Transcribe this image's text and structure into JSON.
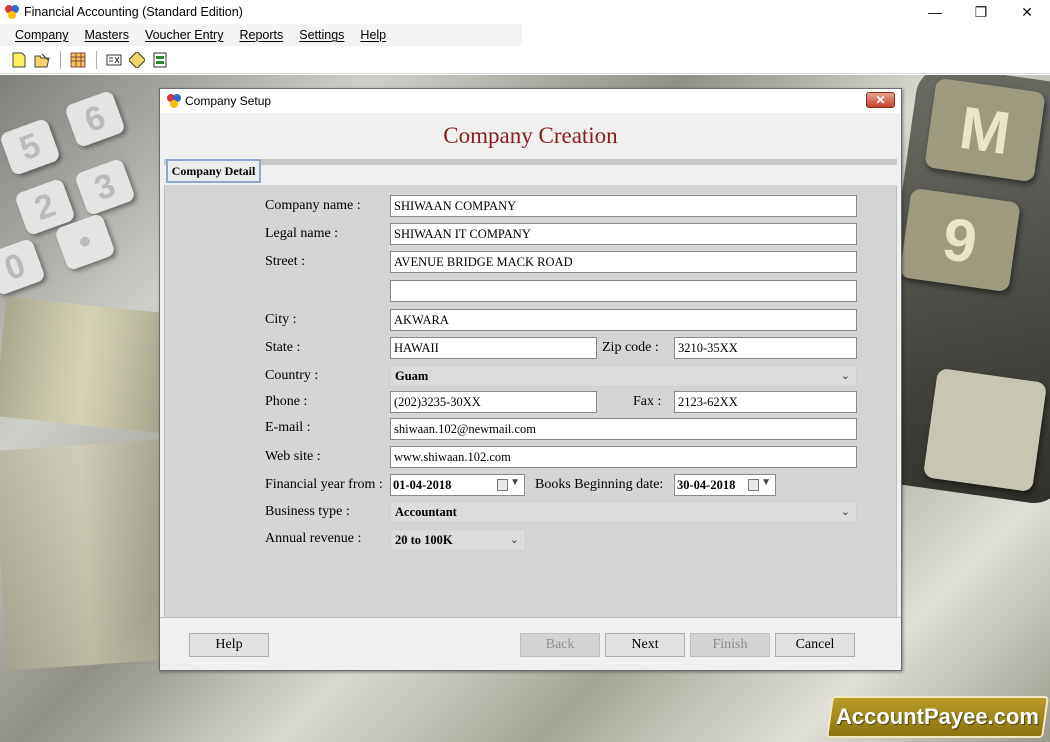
{
  "app": {
    "title": "Financial Accounting (Standard Edition)"
  },
  "window_controls": {
    "minimize": "—",
    "maximize": "❐",
    "close": "✕"
  },
  "menu": [
    "Company",
    "Masters",
    "Voucher Entry",
    "Reports",
    "Settings",
    "Help"
  ],
  "dialog": {
    "title": "Company Setup",
    "close_glyph": "✕",
    "heading": "Company Creation",
    "tab": "Company Detail"
  },
  "form": {
    "company_name_label": "Company name :",
    "company_name": "SHIWAAN COMPANY",
    "legal_name_label": "Legal name :",
    "legal_name": "SHIWAAN IT COMPANY",
    "street_label": "Street :",
    "street1": "AVENUE BRIDGE MACK ROAD",
    "street2": "",
    "city_label": "City :",
    "city": "AKWARA",
    "state_label": "State :",
    "state": "HAWAII",
    "zip_label": "Zip code :",
    "zip": "3210-35XX",
    "country_label": "Country :",
    "country": "Guam",
    "phone_label": "Phone :",
    "phone": "(202)3235-30XX",
    "fax_label": "Fax :",
    "fax": "2123-62XX",
    "email_label": "E-mail :",
    "email": "shiwaan.102@newmail.com",
    "website_label": "Web site :",
    "website": "www.shiwaan.102.com",
    "fy_label": "Financial year from :",
    "fy_from": "01-04-2018",
    "books_label": "Books Beginning date:",
    "books_date": "30-04-2018",
    "business_label": "Business type :",
    "business_type": "Accountant",
    "revenue_label": "Annual revenue :",
    "annual_revenue": "20 to 100K"
  },
  "buttons": {
    "help": "Help",
    "back": "Back",
    "next": "Next",
    "finish": "Finish",
    "cancel": "Cancel"
  },
  "branding": {
    "logo": "AccountPayee.com"
  }
}
